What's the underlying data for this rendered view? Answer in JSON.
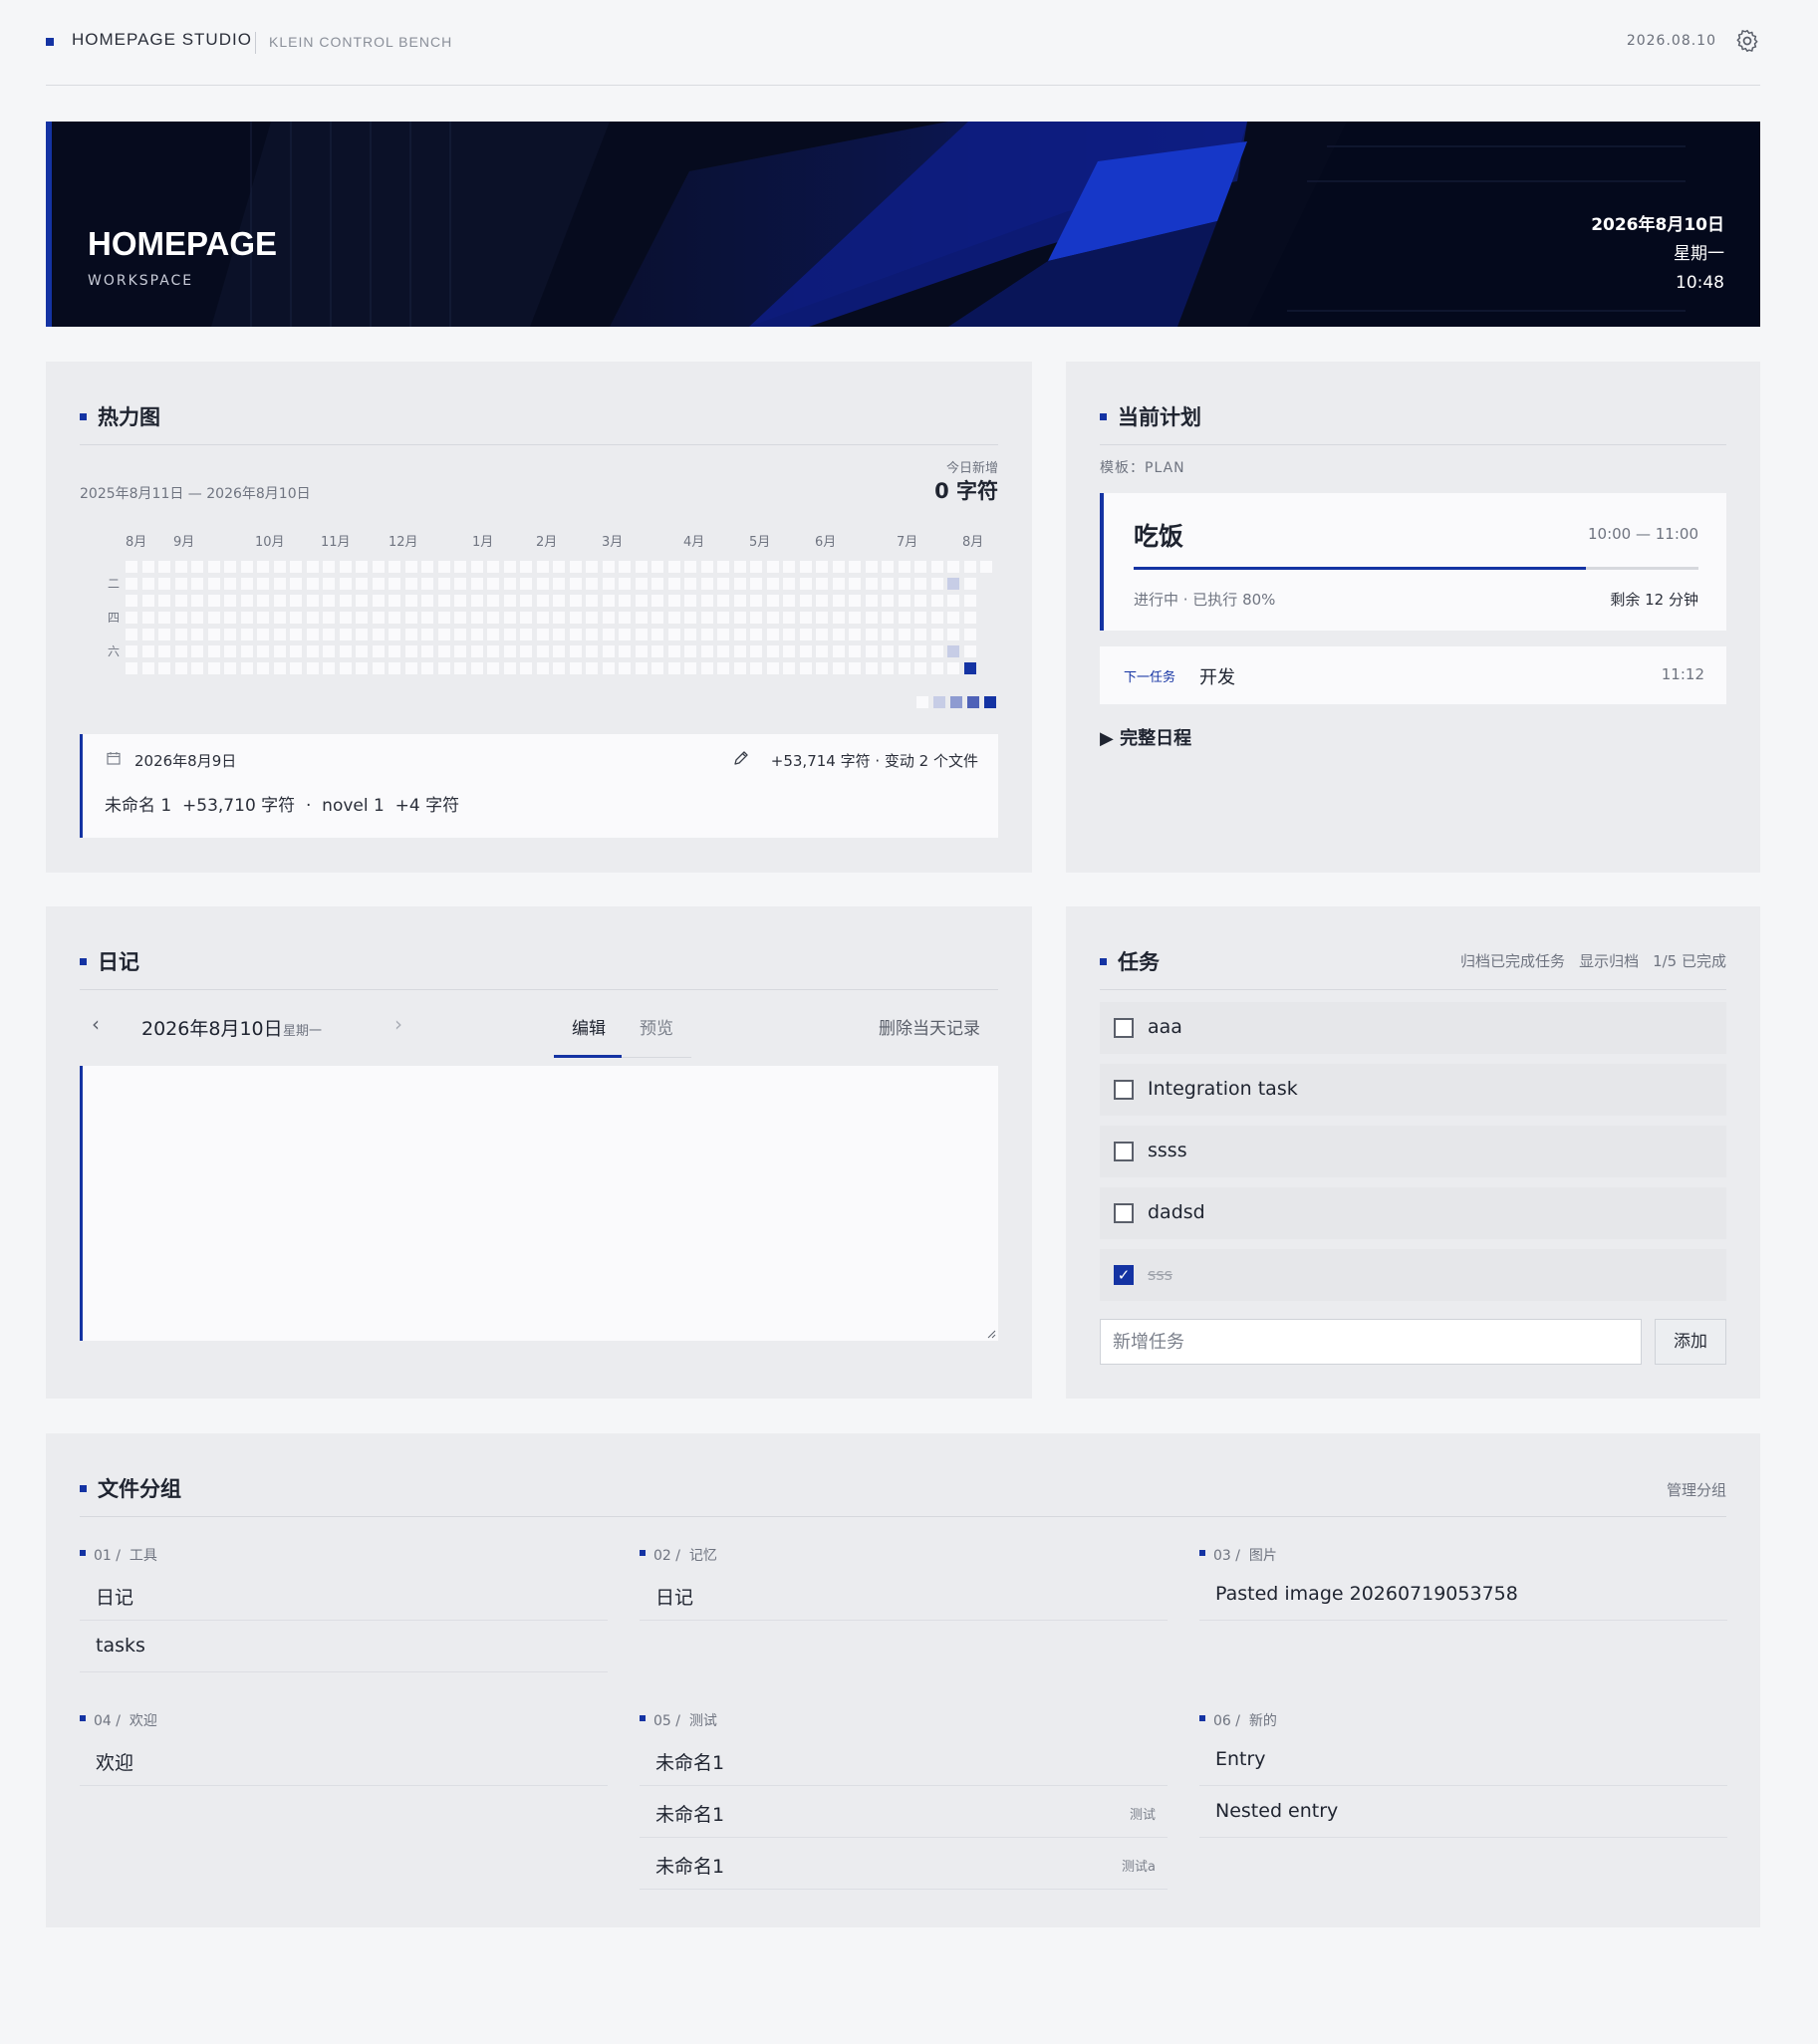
{
  "topbar": {
    "brand": "HOMEPAGE STUDIO",
    "sub": "KLEIN CONTROL BENCH",
    "date": "2026.08.10",
    "settings_icon": "gear-icon"
  },
  "hero": {
    "title": "HOMEPAGE",
    "subtitle": "WORKSPACE",
    "date": "2026年8月10日",
    "weekday": "星期一",
    "time": "10:48"
  },
  "heatmap": {
    "title": "热力图",
    "range": "2025年8月11日 — 2026年8月10日",
    "today_label": "今日新增",
    "today_value": "0 字符",
    "months": [
      "8月",
      "9月",
      "10月",
      "11月",
      "12月",
      "1月",
      "2月",
      "3月",
      "4月",
      "5月",
      "6月",
      "7月",
      "8月"
    ],
    "days": [
      "二",
      "四",
      "六"
    ],
    "weeks": 53,
    "active_cells": [
      {
        "week": 50,
        "day": 1,
        "level": 1
      },
      {
        "week": 50,
        "day": 5,
        "level": 1
      },
      {
        "week": 51,
        "day": 6,
        "level": 4
      }
    ],
    "legend_colors": [
      "#fafafc",
      "#c7cde6",
      "#8e9bd1",
      "#4f62b8",
      "#1433a3"
    ],
    "detail": {
      "date": "2026年8月9日",
      "stats": "+53,714 字符 · 变动 2 个文件",
      "files": "未命名 1  +53,710 字符  ·  novel 1  +4 字符"
    }
  },
  "plan": {
    "title": "当前计划",
    "template": "模板：PLAN",
    "current": {
      "name": "吃饭",
      "time": "10:00 — 11:00",
      "status": "进行中 · 已执行 80%",
      "progress": 0.8,
      "remaining": "剩余 12 分钟"
    },
    "next": {
      "label": "下一任务",
      "name": "开发",
      "time": "11:12"
    },
    "schedule_toggle": "▶ 完整日程"
  },
  "diary": {
    "title": "日记",
    "date": "2026年8月10日",
    "weekday": "星期一",
    "tab_edit": "编辑",
    "tab_preview": "预览",
    "delete": "删除当天记录"
  },
  "tasks": {
    "title": "任务",
    "archive": "归档已完成任务",
    "show_archive": "显示归档",
    "progress": "1/5 已完成",
    "items": [
      {
        "label": "aaa",
        "done": false
      },
      {
        "label": "Integration task",
        "done": false
      },
      {
        "label": "ssss",
        "done": false
      },
      {
        "label": "dadsd",
        "done": false
      },
      {
        "label": "sss",
        "done": true
      }
    ],
    "new_placeholder": "新增任务",
    "add": "添加"
  },
  "groups": {
    "title": "文件分组",
    "manage": "管理分组",
    "list": [
      {
        "head": "01 /  工具",
        "items": [
          {
            "name": "日记",
            "tag": ""
          },
          {
            "name": "tasks",
            "tag": ""
          }
        ]
      },
      {
        "head": "02 /  记忆",
        "items": [
          {
            "name": "日记",
            "tag": ""
          }
        ]
      },
      {
        "head": "03 /  图片",
        "items": [
          {
            "name": "Pasted image 20260719053758",
            "tag": ""
          }
        ]
      },
      {
        "head": "04 /  欢迎",
        "items": [
          {
            "name": "欢迎",
            "tag": ""
          }
        ]
      },
      {
        "head": "05 /  测试",
        "items": [
          {
            "name": "未命名1",
            "tag": ""
          },
          {
            "name": "未命名1",
            "tag": "测试"
          },
          {
            "name": "未命名1",
            "tag": "测试a"
          }
        ]
      },
      {
        "head": "06 /  新的",
        "items": [
          {
            "name": "Entry",
            "tag": ""
          },
          {
            "name": "Nested entry",
            "tag": ""
          }
        ]
      }
    ]
  }
}
